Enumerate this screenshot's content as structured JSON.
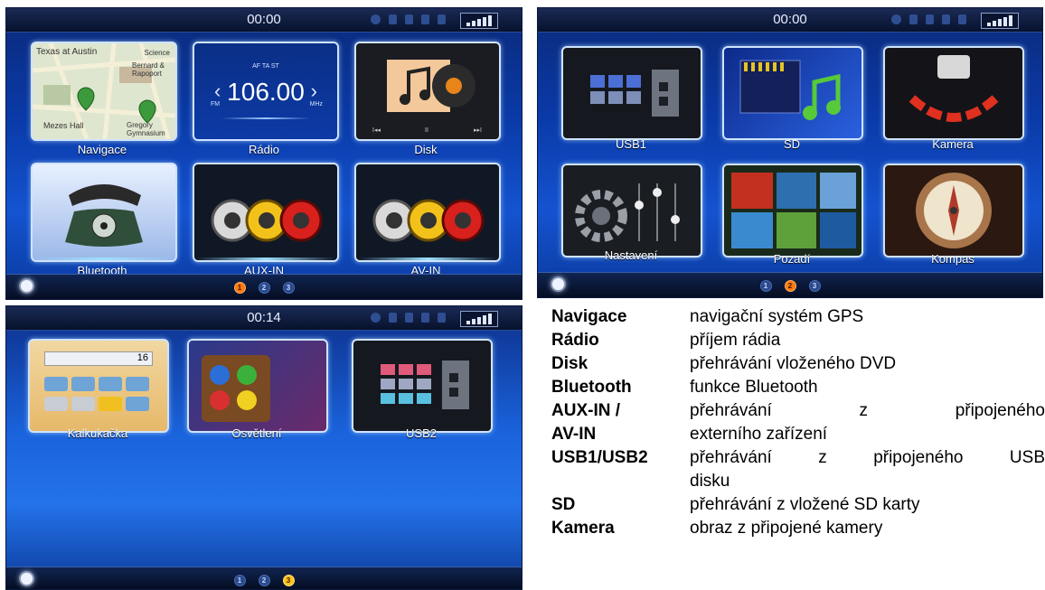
{
  "screen1": {
    "time": "00:00",
    "tiles": [
      {
        "label": "Navigace",
        "map": {
          "a": "Texas at Austin",
          "b": "Science",
          "c": "Bernard & Rapoport",
          "d": "Mezes Hall",
          "e": "Gregory Gymnasium"
        }
      },
      {
        "label": "Rádio",
        "freq": "106.00",
        "band": "FM",
        "unit": "MHz",
        "flags": "AF TA ST"
      },
      {
        "label": "Disk"
      },
      {
        "label": "Bluetooth"
      },
      {
        "label": "AUX-IN"
      },
      {
        "label": "AV-IN"
      }
    ],
    "pages": [
      "1",
      "2",
      "3"
    ],
    "active_page": 1
  },
  "screen2": {
    "time": "00:00",
    "tiles": [
      {
        "label": "USB1"
      },
      {
        "label": "SD"
      },
      {
        "label": "Kamera"
      },
      {
        "label": "Nastavení"
      },
      {
        "label": "Pozadí"
      },
      {
        "label": "Kompas"
      }
    ],
    "pages": [
      "1",
      "2",
      "3"
    ],
    "active_page": 2
  },
  "screen3": {
    "time": "00:14",
    "tiles": [
      {
        "label": "Kalkukačka",
        "display": "16"
      },
      {
        "label": "Osvětlení"
      },
      {
        "label": "USB2"
      }
    ],
    "pages": [
      "1",
      "2",
      "3"
    ],
    "active_page": 3
  },
  "legend": [
    {
      "term": "Navigace",
      "desc": "navigační systém GPS"
    },
    {
      "term": "Rádio",
      "desc": "příjem rádia"
    },
    {
      "term": "Disk",
      "desc": "přehrávání vloženého DVD"
    },
    {
      "term": "Bluetooth",
      "desc": "funkce Bluetooth"
    },
    {
      "term": "AUX-IN /",
      "desc": "přehrávání z připojeného"
    },
    {
      "term": "AV-IN",
      "desc": "externího zařízení"
    },
    {
      "term": "USB1/USB2",
      "desc": "přehrávání z připojeného USB"
    },
    {
      "term": "",
      "desc": "disku"
    },
    {
      "term": "SD",
      "desc": "přehrávání z vložené SD karty"
    },
    {
      "term": "Kamera",
      "desc": "obraz z připojené kamery"
    }
  ]
}
